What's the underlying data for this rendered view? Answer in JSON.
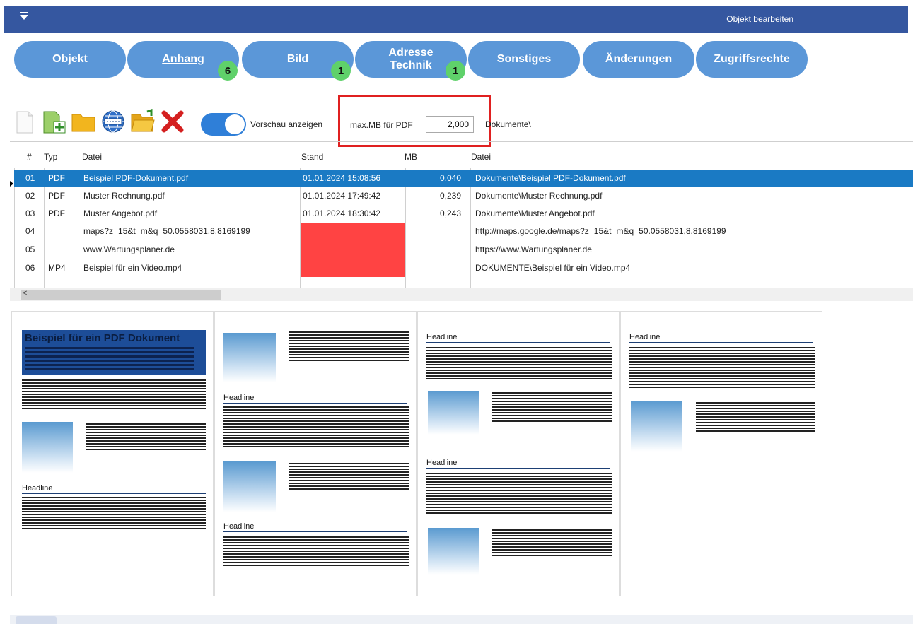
{
  "window": {
    "title": "Objekt bearbeiten"
  },
  "tabs": [
    {
      "label": "Objekt"
    },
    {
      "label": "Anhang",
      "badge": "6"
    },
    {
      "label": "Bild",
      "badge": "1"
    },
    {
      "label": "Adresse\nTechnik",
      "badge": "1"
    },
    {
      "label": "Sonstiges"
    },
    {
      "label": "Änderungen"
    },
    {
      "label": "Zugriffsrechte"
    }
  ],
  "toolbar": {
    "preview_label": "Vorschau anzeigen",
    "maxmb_label": "max.MB für PDF",
    "maxmb_value": "2,000",
    "path_label": "Dokumente\\",
    "icons": [
      "new-document-icon",
      "add-file-icon",
      "folder-icon",
      "web-link-icon",
      "open-folder-icon",
      "delete-icon"
    ]
  },
  "grid": {
    "headers": [
      "#",
      "Typ",
      "Datei",
      "Stand",
      "MB",
      "Datei"
    ],
    "rows": [
      {
        "num": "01",
        "typ": "PDF",
        "datei": "Beispiel PDF-Dokument.pdf",
        "stand": "01.01.2024 15:08:56",
        "mb": "0,040",
        "pfad": "Dokumente\\Beispiel PDF-Dokument.pdf"
      },
      {
        "num": "02",
        "typ": "PDF",
        "datei": "Muster Rechnung.pdf",
        "stand": "01.01.2024 17:49:42",
        "mb": "0,239",
        "pfad": "Dokumente\\Muster Rechnung.pdf"
      },
      {
        "num": "03",
        "typ": "PDF",
        "datei": "Muster Angebot.pdf",
        "stand": "01.01.2024 18:30:42",
        "mb": "0,243",
        "pfad": "Dokumente\\Muster Angebot.pdf"
      },
      {
        "num": "04",
        "typ": "",
        "datei": "maps?z=15&t=m&q=50.0558031,8.8169199",
        "stand": "",
        "mb": "",
        "pfad": "http://maps.google.de/maps?z=15&t=m&q=50.0558031,8.8169199"
      },
      {
        "num": "05",
        "typ": "",
        "datei": "www.Wartungsplaner.de",
        "stand": "",
        "mb": "",
        "pfad": "https://www.Wartungsplaner.de"
      },
      {
        "num": "06",
        "typ": "MP4",
        "datei": "Beispiel für ein Video.mp4",
        "stand": "",
        "mb": "",
        "pfad": "DOKUMENTE\\Beispiel für ein Video.mp4"
      }
    ],
    "scroll_arrow": "<"
  },
  "preview": {
    "hero_title": "Beispiel für ein PDF Dokument",
    "headline": "Headline"
  }
}
